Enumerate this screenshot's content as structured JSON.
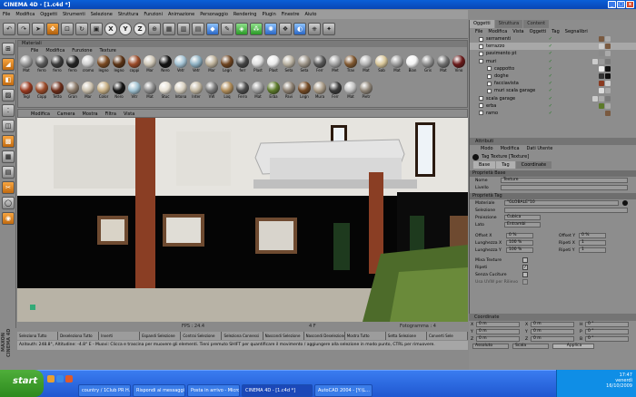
{
  "window": {
    "title": "CINEMA 4D - [1.c4d *]"
  },
  "menu": [
    "File",
    "Modifica",
    "Oggetti",
    "Strumenti",
    "Selezione",
    "Struttura",
    "Funzioni",
    "Animazione",
    "Personaggio",
    "Rendering",
    "Plugin",
    "Finestre",
    "Aiuto"
  ],
  "toolbar_icons": [
    {
      "name": "undo-icon",
      "g": "↶",
      "s": "gray"
    },
    {
      "name": "redo-icon",
      "g": "↷",
      "s": "gray"
    },
    {
      "name": "select-icon",
      "g": "➤",
      "s": "gray"
    },
    {
      "name": "move-icon",
      "g": "✥",
      "s": "orange"
    },
    {
      "name": "scale-icon",
      "g": "⊡",
      "s": "gray"
    },
    {
      "name": "rotate-icon",
      "g": "↻",
      "s": "gray"
    },
    {
      "name": "object-icon",
      "g": "▣",
      "s": "gray"
    },
    {
      "name": "x-axis-icon",
      "g": "X",
      "s": "circle"
    },
    {
      "name": "y-axis-icon",
      "g": "Y",
      "s": "circle"
    },
    {
      "name": "z-axis-icon",
      "g": "Z",
      "s": "circle"
    },
    {
      "name": "world-icon",
      "g": "⊕",
      "s": "gray"
    },
    {
      "name": "render-view-icon",
      "g": "▦",
      "s": "gray"
    },
    {
      "name": "render-picture-icon",
      "g": "▥",
      "s": "gray"
    },
    {
      "name": "render-settings-icon",
      "g": "▤",
      "s": "gray"
    },
    {
      "name": "cube-icon",
      "g": "◆",
      "s": "blue"
    },
    {
      "name": "spline-icon",
      "g": "✎",
      "s": "gray"
    },
    {
      "name": "nurbs-icon",
      "g": "◈",
      "s": "green"
    },
    {
      "name": "array-icon",
      "g": "⁂",
      "s": "green"
    },
    {
      "name": "deformer-icon",
      "g": "✺",
      "s": "blue"
    },
    {
      "name": "scene-icon",
      "g": "❖",
      "s": "gray"
    },
    {
      "name": "environment-icon",
      "g": "◐",
      "s": "blue"
    },
    {
      "name": "camera-icon",
      "g": "⎈",
      "s": "gray"
    },
    {
      "name": "light-icon",
      "g": "✦",
      "s": "gray"
    }
  ],
  "left_tools": [
    {
      "name": "make-editable-icon",
      "g": "⊞"
    },
    {
      "name": "model-tool-icon",
      "g": "◢",
      "o": true
    },
    {
      "name": "object-tool-icon",
      "g": "◧",
      "o": true
    },
    {
      "name": "texture-tool-icon",
      "g": "▨"
    },
    {
      "name": "points-tool-icon",
      "g": "⁚"
    },
    {
      "name": "edges-tool-icon",
      "g": "◫"
    },
    {
      "name": "polygons-tool-icon",
      "g": "▩",
      "o": true
    },
    {
      "name": "checker-icon",
      "g": "▦"
    },
    {
      "name": "grid-icon",
      "g": "▤"
    },
    {
      "name": "knife-icon",
      "g": "✂",
      "o": true
    },
    {
      "name": "magnet-icon",
      "g": "◯"
    },
    {
      "name": "paint-icon",
      "g": "◉",
      "o": true
    }
  ],
  "materials_panel": {
    "title": "Materiali",
    "menu": [
      "File",
      "Modifica",
      "Funzione",
      "Texture"
    ]
  },
  "materials": [
    {
      "n": "Mat",
      "c": "#9a9a9a"
    },
    {
      "n": "ferro",
      "c": "#5a5a5a"
    },
    {
      "n": "ferro",
      "c": "#3a3a3a"
    },
    {
      "n": "ferro",
      "c": "#222222"
    },
    {
      "n": "cromo",
      "c": "#cfcfcf"
    },
    {
      "n": "legno",
      "c": "#7a4a22"
    },
    {
      "n": "legno",
      "c": "#5a3214"
    },
    {
      "n": "coppi",
      "c": "#9a4a28"
    },
    {
      "n": "Mar",
      "c": "#cfc7b7"
    },
    {
      "n": "Nero",
      "c": "#111111"
    },
    {
      "n": "Vetr",
      "c": "#a4c3d4"
    },
    {
      "n": "Vetr",
      "c": "#8db0c2"
    },
    {
      "n": "Mar",
      "c": "#bdb19a"
    },
    {
      "n": "Legn",
      "c": "#6e4420"
    },
    {
      "n": "ferr",
      "c": "#444444"
    },
    {
      "n": "Plast",
      "c": "#dedede"
    },
    {
      "n": "Plast",
      "c": "#eaeaea"
    },
    {
      "n": "Seta",
      "c": "#b8b0a0"
    },
    {
      "n": "Seta",
      "c": "#9c9488"
    },
    {
      "n": "Ferr",
      "c": "#575757"
    },
    {
      "n": "Met",
      "c": "#a2a2a2"
    },
    {
      "n": "Trav",
      "c": "#805830"
    },
    {
      "n": "Mat",
      "c": "#b4b4b4"
    },
    {
      "n": "Sab",
      "c": "#d9c79a"
    },
    {
      "n": "Mat",
      "c": "#9e9e9e"
    },
    {
      "n": "Bian",
      "c": "#f3f3f3"
    },
    {
      "n": "Gris",
      "c": "#8e8e8e"
    },
    {
      "n": "Mat",
      "c": "#707070"
    },
    {
      "n": "Vino",
      "c": "#6a1a1a"
    },
    {
      "n": "Tegl",
      "c": "#9a3a20"
    },
    {
      "n": "Copp",
      "c": "#9a4a28"
    },
    {
      "n": "Tetto",
      "c": "#6d2e1a"
    },
    {
      "n": "Gran",
      "c": "#8a7a6a"
    },
    {
      "n": "Mar",
      "c": "#c9bfac"
    },
    {
      "n": "Color",
      "c": "#c9b186"
    },
    {
      "n": "Nero",
      "c": "#141414"
    },
    {
      "n": "Vitr",
      "c": "#9ec0d0"
    },
    {
      "n": "Mat",
      "c": "#8a8a8a"
    },
    {
      "n": "Stuc",
      "c": "#e7e1d4"
    },
    {
      "n": "Intona",
      "c": "#d8d0c0"
    },
    {
      "n": "Inter",
      "c": "#c4b9a3"
    },
    {
      "n": "VW",
      "c": "#777777"
    },
    {
      "n": "Loq",
      "c": "#b08d5a"
    },
    {
      "n": "Ferro",
      "c": "#4b4b4b"
    },
    {
      "n": "Mat",
      "c": "#9a9a9a"
    },
    {
      "n": "Erba",
      "c": "#5c7a2a"
    },
    {
      "n": "Pavi",
      "c": "#8a7e70"
    },
    {
      "n": "Legn",
      "c": "#744a24"
    },
    {
      "n": "Mura",
      "c": "#a89a86"
    },
    {
      "n": "Ferr",
      "c": "#3a3a3a"
    },
    {
      "n": "Mat",
      "c": "#c0c0c0"
    },
    {
      "n": "Pietr",
      "c": "#8f8578"
    }
  ],
  "viewport": {
    "menu": [
      "Modifica",
      "Camera",
      "Mostra",
      "Filtra",
      "Vista"
    ],
    "fps": "FPS : 24.4",
    "frame": "4 F",
    "frame_total": "Fotogramma : 4"
  },
  "commands": [
    "Seleziona Tutto",
    "Deseleziona Tutto",
    "Inverti",
    "Espandi Selezione",
    "Contrai Selezione",
    "Seleziona Connessi",
    "Nascondi Selezione",
    "Nascondi Deselezione",
    "Mostra Tutto",
    "Setta Selezione",
    "Converti Sele"
  ],
  "status": "Azitouth: 248.8°, Altitudine: -4.8° E - Muovi: Clicca e trascina per muovere gli elementi. Tieni premuto SHIFT per quantificare il movimento / aggiungere alla selezione in modo punto, CTRL per rimuovere.",
  "maxon_label": "MAXON CINEMA 4D",
  "objects": {
    "tabs": [
      "Oggetti",
      "Struttura",
      "Content"
    ],
    "menu": [
      "File",
      "Modifica",
      "Vista",
      "Oggetti",
      "Tag",
      "Segnalibri"
    ],
    "items": [
      {
        "n": "serramenti",
        "d": 0,
        "t": [
          "#7a5a40",
          "#aaa"
        ]
      },
      {
        "n": "terrazzo",
        "d": 0,
        "t": [
          "#ccc",
          "#7a5a40"
        ],
        "sel": true
      },
      {
        "n": "pavimento pt",
        "d": 0,
        "t": [
          "#8a8a8a",
          "#aaa"
        ]
      },
      {
        "n": "muri",
        "d": 0,
        "t": [
          "#ccc",
          "#999",
          "#7a7a7a"
        ]
      },
      {
        "n": "cappotto",
        "d": 1,
        "t": [
          "#eee",
          "#111"
        ]
      },
      {
        "n": "doghe",
        "d": 1,
        "t": [
          "#333",
          "#111"
        ]
      },
      {
        "n": "facciavista",
        "d": 1,
        "t": [
          "#8a3a20",
          "#ccc"
        ]
      },
      {
        "n": "muri scala garage",
        "d": 1,
        "t": [
          "#ddd",
          "#aaa"
        ]
      },
      {
        "n": "scala garage",
        "d": 0,
        "t": [
          "#ccc",
          "#aaa",
          "#7a7a7a"
        ]
      },
      {
        "n": "erba",
        "d": 0,
        "t": [
          "#5c7a2a",
          "#aaa"
        ]
      },
      {
        "n": "ramo",
        "d": 0,
        "t": [
          "#7a5a40"
        ]
      }
    ]
  },
  "attributes": {
    "title": "Attributi",
    "menu": [
      "Modo",
      "Modifica",
      "Dati Utente"
    ],
    "tag_title": "Tag Texture [Texture]",
    "tabs": [
      "Base",
      "Tag",
      "Coordinate"
    ],
    "sect_base": "Proprietà Base",
    "name_label": "Nome",
    "name_value": "Texture",
    "layer_label": "Livello",
    "sect_tag": "Proprietà Tag",
    "material_label": "Materiale",
    "material_value": "\"GLOBALE\"10",
    "selection_label": "Selezione",
    "projection_label": "Proiezione",
    "projection_value": "Cubica",
    "side_label": "Lato",
    "side_value": "Entrambi",
    "offx_label": "Offset X",
    "offx_value": "0 %",
    "offy_label": "Offset Y",
    "offy_value": "0 %",
    "lenx_label": "Lunghezza X",
    "lenx_value": "100 %",
    "tilesx_label": "Ripeti X",
    "tilesx_value": "1",
    "leny_label": "Lunghezza Y",
    "leny_value": "100 %",
    "tilesy_label": "Ripeti Y",
    "tilesy_value": "1",
    "mix_label": "Mixa Texture",
    "tile_label": "Ripeti",
    "seamless_label": "Senza Cuciture",
    "uvw_label": "Usa UVW per Rilievo"
  },
  "coordinates": {
    "title": "Coordinate",
    "rows": [
      [
        "X",
        "0 m",
        "X",
        "0 m",
        "H",
        "0 °"
      ],
      [
        "Y",
        "0 m",
        "Y",
        "0 m",
        "P",
        "0 °"
      ],
      [
        "Z",
        "0 m",
        "Z",
        "0 m",
        "B",
        "0 °"
      ]
    ],
    "mode1": "Assoluto",
    "mode2": "Scala",
    "apply": "Applica"
  },
  "taskbar": {
    "start": "start",
    "tasks": [
      "country / 1Club PR H...",
      "Rispondi al messaggio:...",
      "Posta in arrivo - Micro...",
      "CINEMA 4D - [1.c4d *]",
      "AutoCAD 2004 - [Y:\\L..."
    ],
    "time": "17:47",
    "day": "venerdì",
    "date": "16/10/2009"
  }
}
